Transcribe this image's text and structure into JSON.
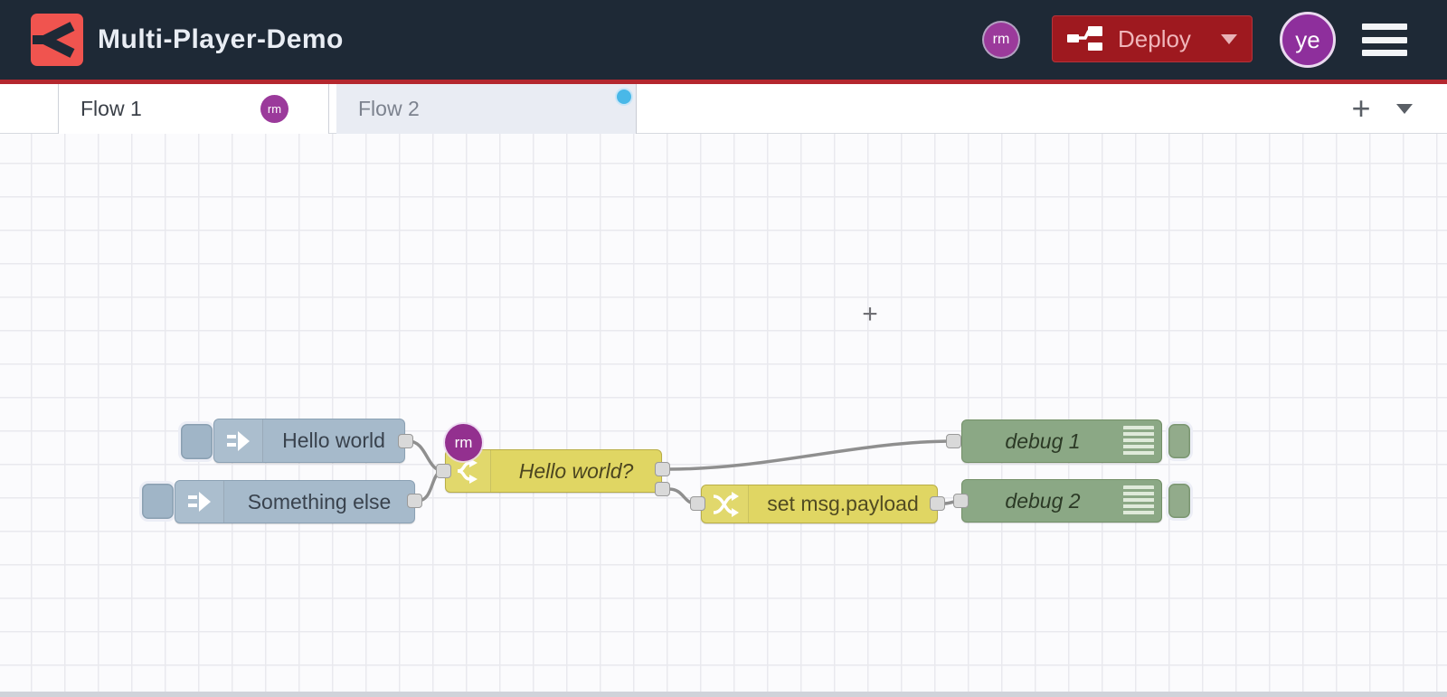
{
  "header": {
    "title": "Multi-Player-Demo",
    "logo": "flowfuse-logo",
    "collaborator_badge": "rm",
    "deploy": {
      "label": "Deploy"
    },
    "user_avatar": "ye",
    "colors": {
      "header_bg": "#1e2936",
      "accent_red": "#b4272e",
      "deploy_bg": "#9e191f",
      "avatar_purple": "#8e2f9c"
    }
  },
  "tabs": {
    "items": [
      {
        "label": "Flow 1",
        "active": true,
        "badge": "rm"
      },
      {
        "label": "Flow 2",
        "active": false,
        "activity_dot_color": "#49b8e8"
      }
    ],
    "add_button": "+",
    "menu_button": "open-tab-list"
  },
  "canvas": {
    "nodes": [
      {
        "id": "inject1",
        "type": "inject",
        "label": "Hello world"
      },
      {
        "id": "inject2",
        "type": "inject",
        "label": "Something else"
      },
      {
        "id": "switch1",
        "type": "switch",
        "label": "Hello world?",
        "badge": "rm"
      },
      {
        "id": "change1",
        "type": "change",
        "label": "set msg.payload"
      },
      {
        "id": "debug1",
        "type": "debug",
        "label": "debug 1"
      },
      {
        "id": "debug2",
        "type": "debug",
        "label": "debug 2"
      }
    ],
    "wires": [
      {
        "from": "inject1",
        "to": "switch1"
      },
      {
        "from": "inject2",
        "to": "switch1"
      },
      {
        "from": "switch1:out1",
        "to": "debug1"
      },
      {
        "from": "switch1:out2",
        "to": "change1"
      },
      {
        "from": "change1",
        "to": "debug2"
      }
    ],
    "node_colors": {
      "inject": "#a6bacb",
      "function_yellow": "#e0d663",
      "debug_green": "#8ba885"
    }
  }
}
